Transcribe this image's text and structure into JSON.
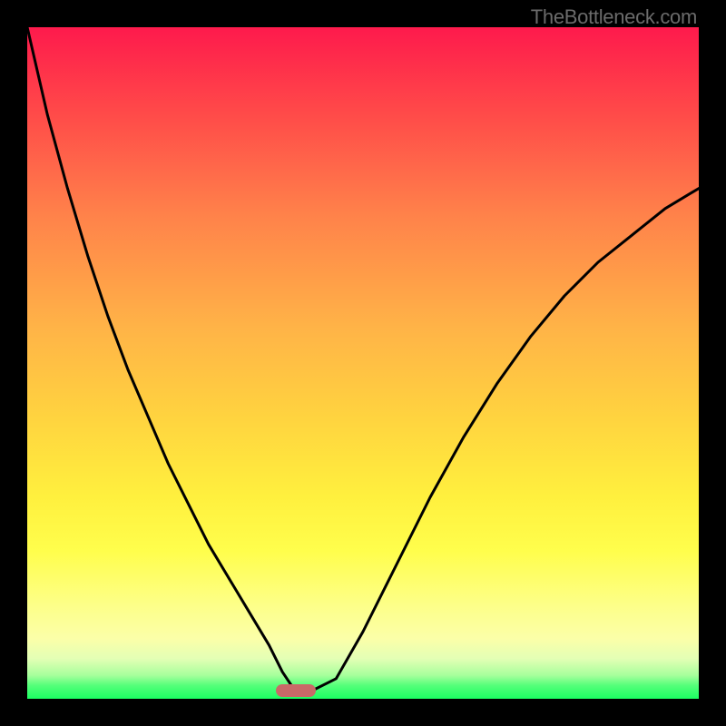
{
  "watermark": "TheBottleneck.com",
  "colors": {
    "gradient_top": "#fe1a4c",
    "gradient_mid1": "#ff824a",
    "gradient_mid2": "#ffd33f",
    "gradient_mid3": "#fffe4c",
    "gradient_mid4": "#fbffa8",
    "gradient_bottom": "#1bff62",
    "curve": "#000000",
    "marker": "#c96968",
    "background": "#000000"
  },
  "chart_data": {
    "type": "line",
    "title": "",
    "xlabel": "",
    "ylabel": "",
    "xlim": [
      0,
      100
    ],
    "ylim": [
      0,
      100
    ],
    "series": [
      {
        "name": "bottleneck_curve",
        "x": [
          0,
          3,
          6,
          9,
          12,
          15,
          18,
          21,
          24,
          27,
          30,
          33,
          36,
          38,
          40,
          42,
          46,
          50,
          55,
          60,
          65,
          70,
          75,
          80,
          85,
          90,
          95,
          100
        ],
        "y": [
          100,
          87,
          76,
          66,
          57,
          49,
          42,
          35,
          29,
          23,
          18,
          13,
          8,
          4,
          1,
          1,
          3,
          10,
          20,
          30,
          39,
          47,
          54,
          60,
          65,
          69,
          73,
          76
        ]
      }
    ],
    "marker": {
      "x_center": 40,
      "width": 6,
      "y": 0
    }
  }
}
